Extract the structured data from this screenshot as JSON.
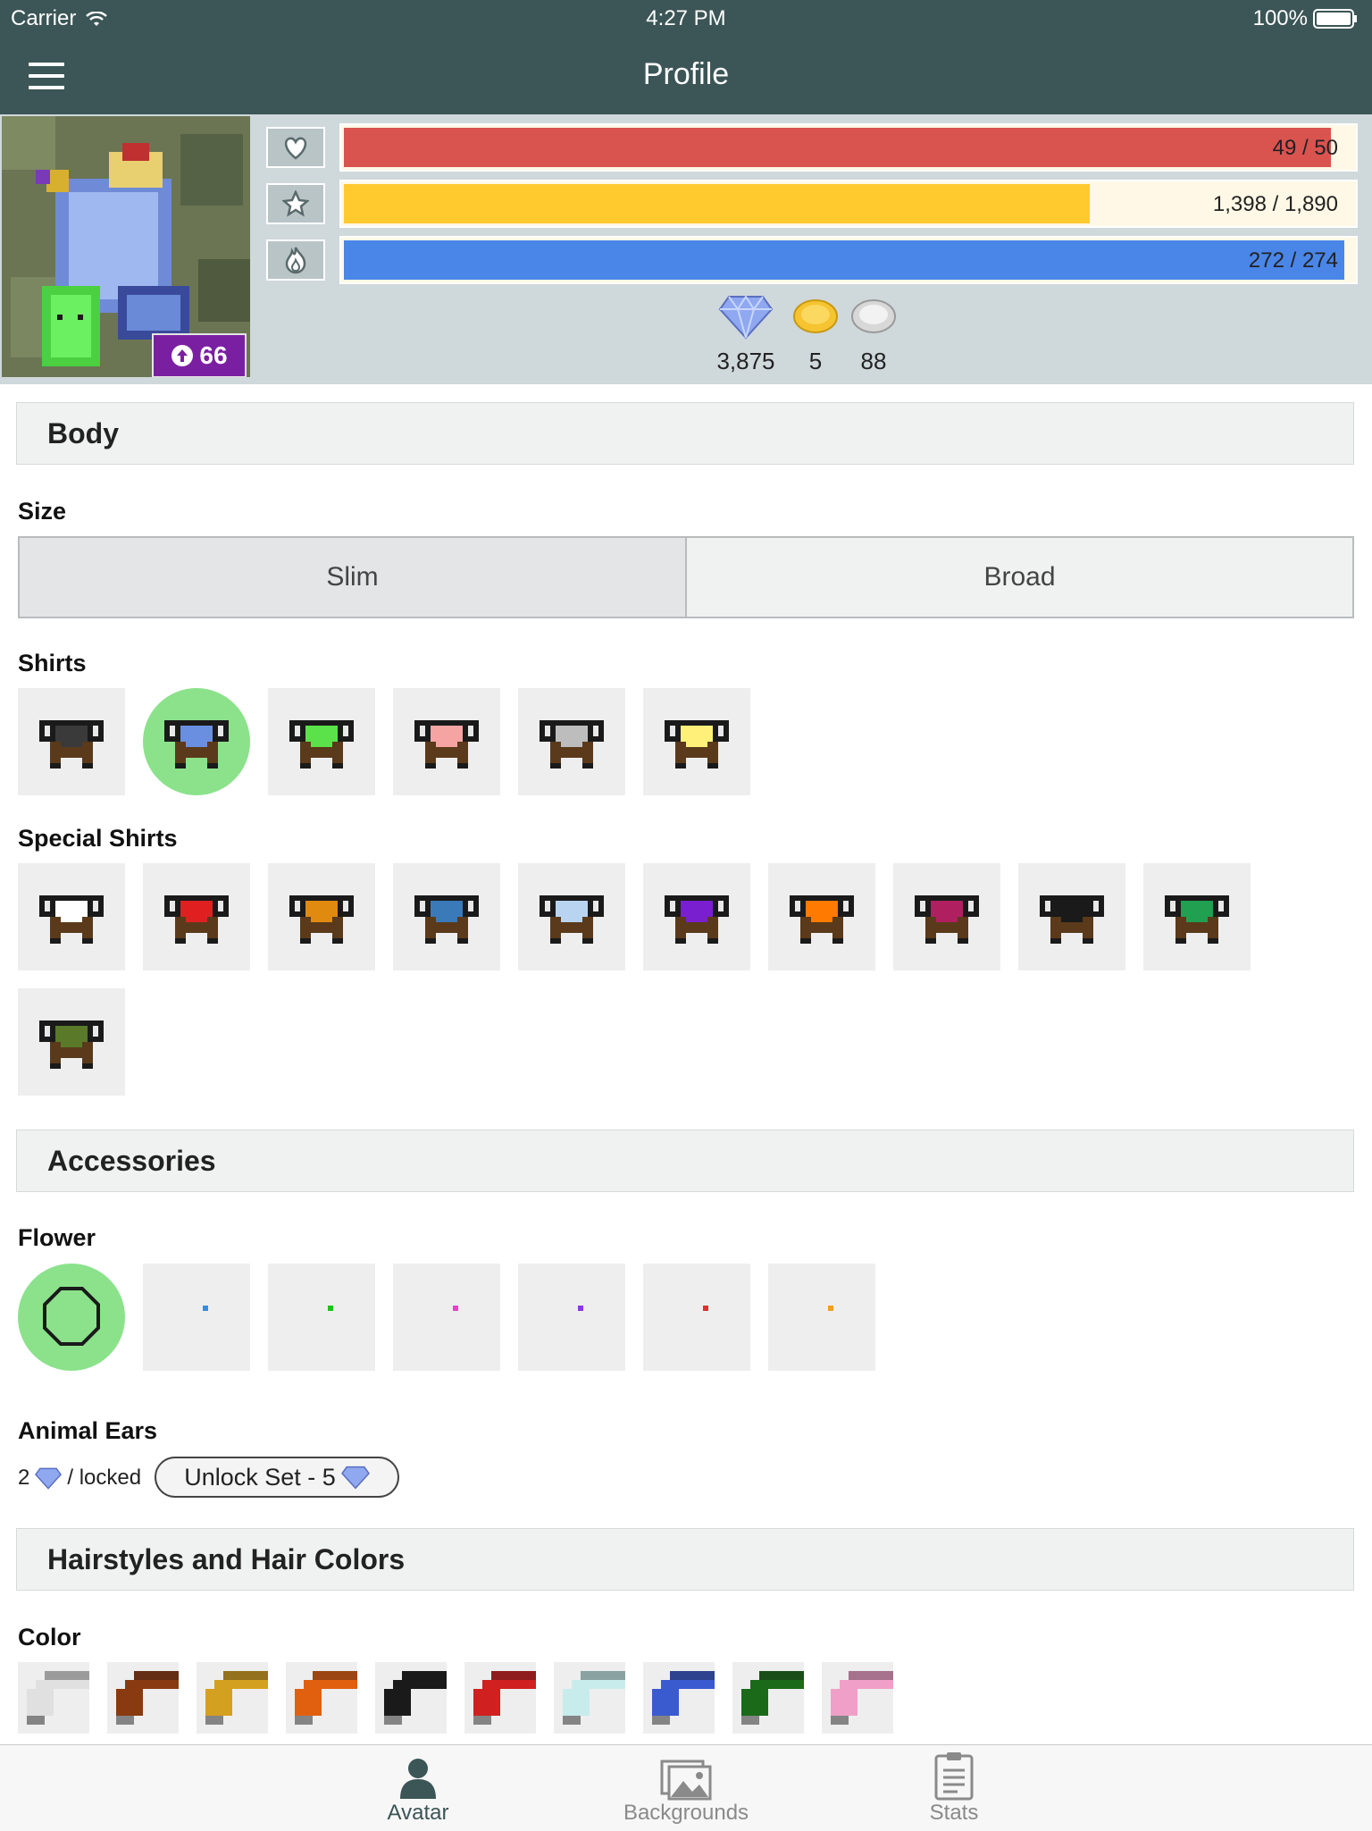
{
  "status_bar": {
    "carrier": "Carrier",
    "time": "4:27 PM",
    "battery": "100%"
  },
  "nav": {
    "title": "Profile"
  },
  "avatar": {
    "level": "66"
  },
  "stats": {
    "health": {
      "text": "49 / 50",
      "fraction": 0.98,
      "color": "#d9534f"
    },
    "experience": {
      "text": "1,398 / 1,890",
      "fraction": 0.74,
      "color": "#ffca2e"
    },
    "mana": {
      "text": "272 / 274",
      "fraction": 0.993,
      "color": "#4a86e8"
    }
  },
  "currency": {
    "gems": "3,875",
    "gold": "5",
    "silver": "88"
  },
  "sections": {
    "body": "Body",
    "accessories": "Accessories",
    "hair": "Hairstyles and Hair Colors"
  },
  "labels": {
    "size": "Size",
    "shirts": "Shirts",
    "special_shirts": "Special Shirts",
    "flower": "Flower",
    "animal_ears": "Animal Ears",
    "color": "Color"
  },
  "size_options": {
    "slim": "Slim",
    "broad": "Broad",
    "selected": "Slim"
  },
  "shirts": [
    {
      "color": "#3a3a3a"
    },
    {
      "color": "#6a8fe0",
      "selected": true
    },
    {
      "color": "#5be24a"
    },
    {
      "color": "#f5a3a3"
    },
    {
      "color": "#bdbdbd"
    },
    {
      "color": "#fff07a"
    }
  ],
  "special_shirts": [
    {
      "color": "#ffffff"
    },
    {
      "color": "#e02020"
    },
    {
      "color": "#e08a10"
    },
    {
      "color": "#3a7ab8"
    },
    {
      "color": "#b8d4f0"
    },
    {
      "color": "#7a1fd0"
    },
    {
      "color": "#ff7a00"
    },
    {
      "color": "#b02060"
    },
    {
      "color": "#1a1a1a"
    },
    {
      "color": "#20a050"
    },
    {
      "color": "#5a7a2a"
    }
  ],
  "flowers": [
    {
      "color": "none",
      "selected": true
    },
    {
      "color": "#3a8ae8"
    },
    {
      "color": "#20c020"
    },
    {
      "color": "#f040c0"
    },
    {
      "color": "#8a3ae0"
    },
    {
      "color": "#e03030"
    },
    {
      "color": "#f0a020"
    }
  ],
  "animal_ears": {
    "price": "2",
    "status": "/ locked",
    "unlock_label": "Unlock Set - 5"
  },
  "hair_colors": [
    {
      "color": "#e0e0e0"
    },
    {
      "color": "#8a3a10"
    },
    {
      "color": "#d4a020"
    },
    {
      "color": "#e06010"
    },
    {
      "color": "#1a1a1a"
    },
    {
      "color": "#d02020"
    },
    {
      "color": "#c8ecec"
    },
    {
      "color": "#3a5ad0"
    },
    {
      "color": "#1a6a1a"
    },
    {
      "color": "#f0a0c8"
    }
  ],
  "tabs": {
    "avatar": "Avatar",
    "backgrounds": "Backgrounds",
    "stats": "Stats",
    "active": "avatar"
  }
}
